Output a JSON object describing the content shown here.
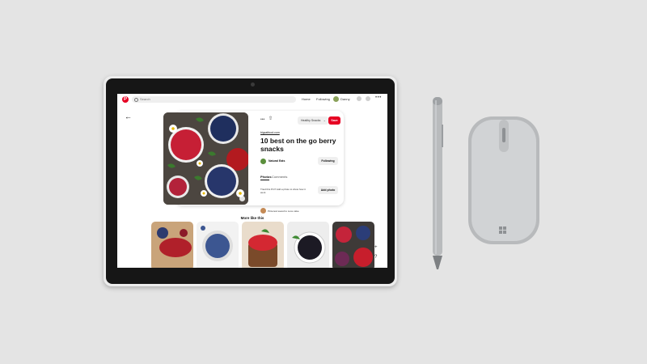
{
  "header": {
    "logo": "P",
    "search_placeholder": "Search",
    "nav_home": "Home",
    "nav_following": "Following",
    "user_name": "Danny",
    "more": "•••"
  },
  "pin": {
    "source": "bigcatfood.com",
    "title": "10 best on the go berry snacks",
    "board_select": "Healthy Snacks",
    "save_label": "Save",
    "creator": "Natural Eats",
    "following_label": "Following",
    "tab_photos": "Photos",
    "tab_comments": "Comments",
    "tried_text": "Tried this Pin? Add a photo to show how it went",
    "add_photo_label": "Add photo",
    "comment_text": "Pinterest saved to Love cake"
  },
  "more_like_this": "More like this",
  "icons": {
    "back": "back-arrow-icon",
    "search": "search-icon",
    "share": "share-icon",
    "zoom": "plus-icon",
    "help": "question-icon"
  },
  "colors": {
    "brand": "#e60023",
    "background": "#e4e4e4"
  }
}
